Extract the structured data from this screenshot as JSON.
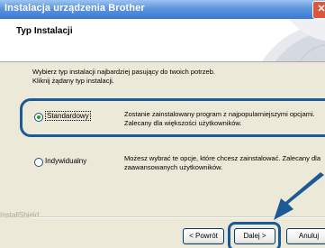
{
  "window": {
    "title": "Instalacja urządzenia Brother",
    "close_glyph": "✕"
  },
  "header": {
    "title": "Typ Instalacji"
  },
  "description": {
    "line1": "Wybierz typ instalacji najbardziej pasujący do twoich potrzeb.",
    "line2": "Kliknij żądany typ instalacji."
  },
  "options": [
    {
      "label": "Standardowy",
      "selected": true,
      "desc_line1": "Zostanie zainstalowany program z najpopularniejszymi opcjami.",
      "desc_line2": "Zalecany dla większości użytkowników."
    },
    {
      "label": "Indywidualny",
      "selected": false,
      "desc_line1": "Możesz wybrać te opcje, które chcesz zainstalować. Zalecany dla",
      "desc_line2": "zaawansowanych użytkowników."
    }
  ],
  "footer": {
    "brand": "InstallShield"
  },
  "buttons": {
    "back": "< Powrót",
    "next": "Dalej >",
    "cancel": "Anuluj"
  },
  "colors": {
    "highlight": "#1c5a95",
    "titlebar": "#3a78d4"
  }
}
